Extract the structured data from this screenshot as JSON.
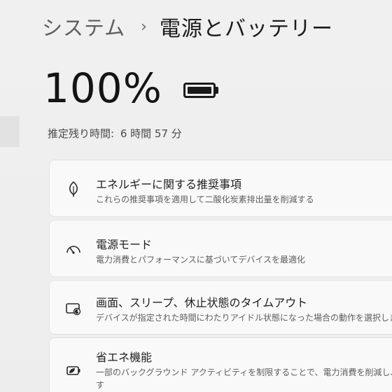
{
  "breadcrumb": {
    "parent": "システム",
    "separator": "›",
    "current": "電源とバッテリー"
  },
  "battery": {
    "percent_text": "100%",
    "level": 1.0,
    "icon": "battery-full-icon"
  },
  "remaining": {
    "label": "推定残り時間:",
    "value": "6 時間 57 分"
  },
  "cards": [
    {
      "icon": "leaf-icon",
      "title": "エネルギーに関する推奨事項",
      "description": "これらの推奨事項を適用して二酸化炭素排出量を削減する"
    },
    {
      "icon": "gauge-icon",
      "title": "電源モード",
      "description": "電力消費とパフォーマンスに基づいてデバイスを最適化"
    },
    {
      "icon": "screen-sleep-icon",
      "title": "画面、スリープ、休止状態のタイムアウト",
      "description": "デバイスが指定された時間にわたりアイドル状態になった場合の動作を選択します"
    },
    {
      "icon": "battery-saver-icon",
      "title": "省エネ機能",
      "description": "一部のバックグラウンド アクティビティを制限することで、電力消費を削減し、バッ",
      "description_line2": "す"
    }
  ]
}
